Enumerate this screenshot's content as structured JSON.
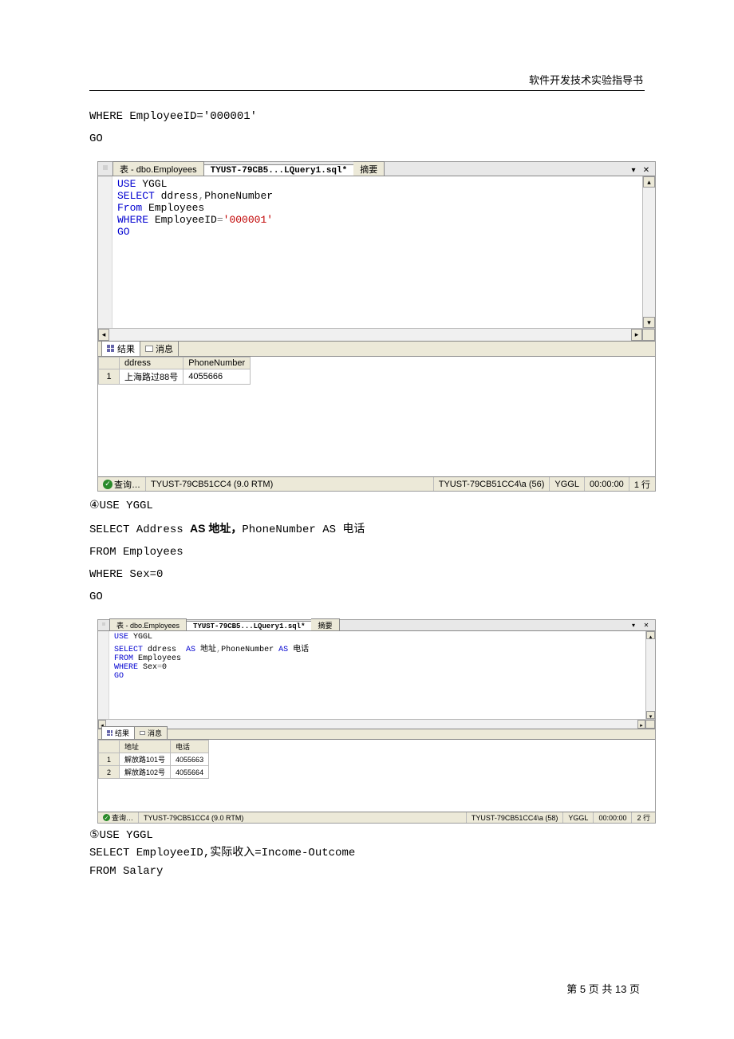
{
  "header": {
    "title": "软件开发技术实验指导书"
  },
  "pre_text": {
    "line1": "WHERE EmployeeID='000001'",
    "line2": "GO"
  },
  "screenshot1": {
    "tabs": {
      "table": "表 - dbo.Employees",
      "query": "TYUST-79CB5...LQuery1.sql*",
      "summary": "摘要"
    },
    "code": "USE YGGL\nSELECT ddress,PhoneNumber\nFrom Employees\nWHERE EmployeeID='000001'\nGO",
    "code_lines": [
      {
        "t": "USE",
        "c": "kw-blue"
      },
      {
        "t": " YGGL",
        "c": ""
      },
      {
        "t": "\n"
      },
      {
        "t": "SELECT",
        "c": "kw-blue"
      },
      {
        "t": " ddress",
        "c": ""
      },
      {
        "t": ",",
        "c": "kw-gray"
      },
      {
        "t": "PhoneNumber",
        "c": ""
      },
      {
        "t": "\n"
      },
      {
        "t": "From",
        "c": "kw-blue"
      },
      {
        "t": " Employees",
        "c": ""
      },
      {
        "t": "\n"
      },
      {
        "t": "WHERE",
        "c": "kw-blue"
      },
      {
        "t": " EmployeeID",
        "c": ""
      },
      {
        "t": "=",
        "c": "kw-gray"
      },
      {
        "t": "'000001'",
        "c": "kw-red"
      },
      {
        "t": "\n"
      },
      {
        "t": "GO",
        "c": "kw-blue"
      }
    ],
    "result_tabs": {
      "results": "结果",
      "messages": "消息"
    },
    "result_headers": [
      "ddress",
      "PhoneNumber"
    ],
    "result_rows": [
      {
        "n": "1",
        "c": [
          "上海路过88号",
          "4055666"
        ]
      }
    ],
    "status": {
      "query": "查询…",
      "server": "TYUST-79CB51CC4 (9.0 RTM)",
      "conn": "TYUST-79CB51CC4\\a (56)",
      "db": "YGGL",
      "time": "00:00:00",
      "rows": "1 行"
    },
    "code_pane_h": 190,
    "result_pane_h": 150
  },
  "mid_text": {
    "l1_prefix": "④",
    "l1": "USE YGGL",
    "l2a": "SELECT Address ",
    "l2_as1": "AS 地址，",
    "l2b": "PhoneNumber AS 电话",
    "l3": "FROM Employees",
    "l4": "WHERE Sex=0",
    "l5": "GO"
  },
  "screenshot2": {
    "tabs": {
      "table": "表 - dbo.Employees",
      "query": "TYUST-79CB5...LQuery1.sql*",
      "summary": "摘要"
    },
    "code_lines": [
      {
        "t": "USE",
        "c": "kw-blue"
      },
      {
        "t": " YGGL",
        "c": ""
      },
      {
        "t": "\n"
      },
      {
        "t": "SELECT",
        "c": "kw-blue"
      },
      {
        "t": " ddress  ",
        "c": ""
      },
      {
        "t": "AS",
        "c": "kw-blue"
      },
      {
        "t": " 地址",
        "c": ""
      },
      {
        "t": ",",
        "c": "kw-gray"
      },
      {
        "t": "PhoneNumber ",
        "c": ""
      },
      {
        "t": "AS",
        "c": "kw-blue"
      },
      {
        "t": " 电话",
        "c": ""
      },
      {
        "t": "\n"
      },
      {
        "t": "FROM",
        "c": "kw-blue"
      },
      {
        "t": " Employees",
        "c": ""
      },
      {
        "t": "\n"
      },
      {
        "t": "WHERE",
        "c": "kw-blue"
      },
      {
        "t": " Sex",
        "c": ""
      },
      {
        "t": "=",
        "c": "kw-gray"
      },
      {
        "t": "0",
        "c": ""
      },
      {
        "t": "\n"
      },
      {
        "t": "GO",
        "c": "kw-blue"
      }
    ],
    "result_tabs": {
      "results": "结果",
      "messages": "消息"
    },
    "result_headers": [
      "地址",
      "电话"
    ],
    "result_rows": [
      {
        "n": "1",
        "c": [
          "解放路101号",
          "4055663"
        ]
      },
      {
        "n": "2",
        "c": [
          "解放路102号",
          "4055664"
        ]
      }
    ],
    "status": {
      "query": "查询…",
      "server": "TYUST-79CB51CC4 (9.0 RTM)",
      "conn": "TYUST-79CB51CC4\\a (58)",
      "db": "YGGL",
      "time": "00:00:00",
      "rows": "2 行"
    },
    "code_pane_h": 130,
    "result_pane_h": 100,
    "small": true
  },
  "tail_text": {
    "l1_prefix": "⑤",
    "l1": "USE YGGL",
    "l2": "SELECT  EmployeeID,实际收入=Income-Outcome",
    "l3": "FROM Salary"
  },
  "footer": {
    "text": "第 5 页 共 13 页"
  }
}
